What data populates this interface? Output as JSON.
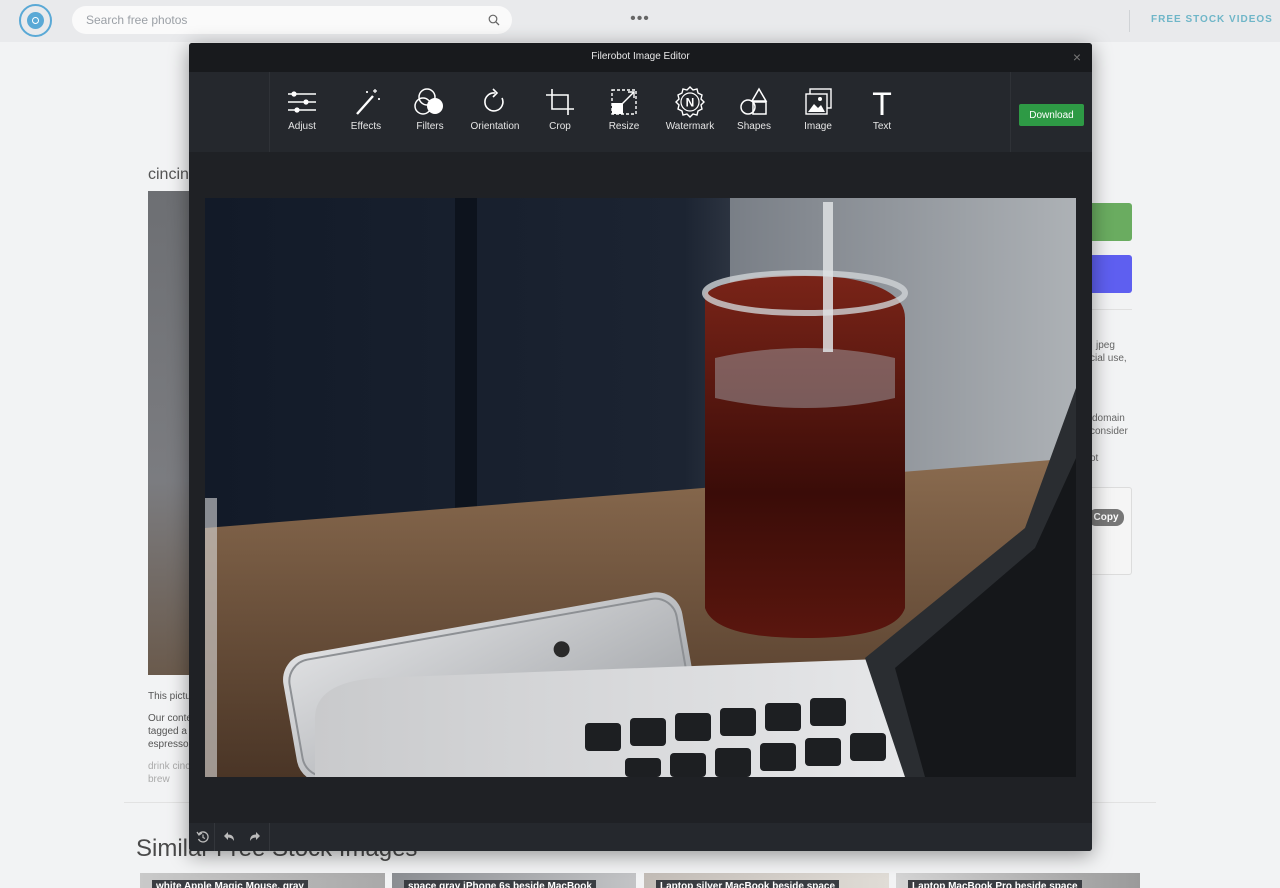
{
  "header": {
    "search": {
      "placeholder": "Search free photos",
      "value": ""
    },
    "more_label": "•••",
    "stock_videos_label": "FREE STOCK VIDEOS"
  },
  "background_page": {
    "title_fragment": "cincin",
    "right_text_fragments": [
      "jpeg",
      "cial use,",
      "domain",
      "consider",
      "ot"
    ],
    "copy_label": "Copy",
    "left_text_fragments": [
      "This pictu",
      "Our conte",
      "tagged a",
      "espresso",
      "drink cinc",
      "brew"
    ],
    "similar_heading": "Similar Free Stock Images",
    "thumbnails": [
      "white Apple Magic Mouse, gray",
      "space gray iPhone 6s beside MacBook",
      "Laptop silver MacBook beside space",
      "Laptop MacBook Pro beside space"
    ]
  },
  "editor": {
    "title": "Filerobot Image Editor",
    "close_label": "×",
    "tools": [
      {
        "label": "Adjust",
        "icon": "sliders-icon"
      },
      {
        "label": "Effects",
        "icon": "magic-wand-icon"
      },
      {
        "label": "Filters",
        "icon": "filters-icon"
      },
      {
        "label": "Orientation",
        "icon": "rotate-icon"
      },
      {
        "label": "Crop",
        "icon": "crop-icon"
      },
      {
        "label": "Resize",
        "icon": "resize-icon"
      },
      {
        "label": "Watermark",
        "icon": "watermark-icon"
      },
      {
        "label": "Shapes",
        "icon": "shapes-icon"
      },
      {
        "label": "Image",
        "icon": "image-icon"
      },
      {
        "label": "Text",
        "icon": "text-icon"
      }
    ],
    "download_label": "Download",
    "watermark_letter": "N",
    "text_tool_letter": "T"
  },
  "colors": {
    "modal_bg": "#1f2125",
    "toolbar_bg": "#25282d",
    "download_green": "#2e9a45",
    "accent_blue": "#5aa9d6"
  }
}
